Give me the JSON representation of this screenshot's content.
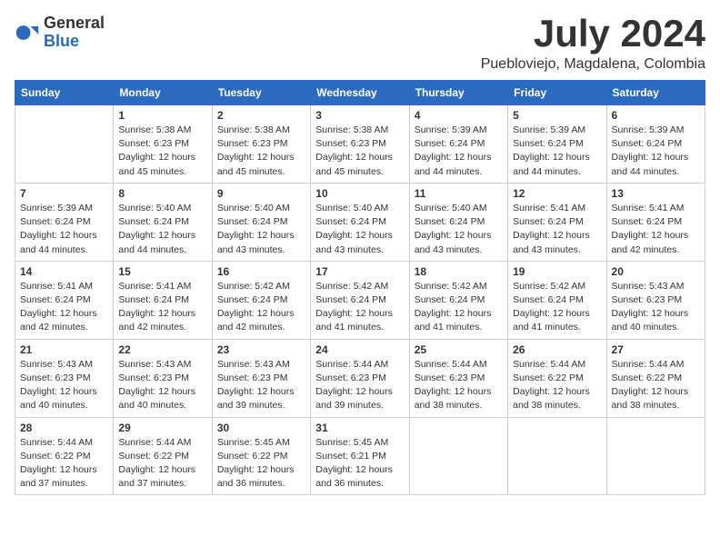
{
  "logo": {
    "general": "General",
    "blue": "Blue"
  },
  "title": "July 2024",
  "location": "Puebloviejo, Magdalena, Colombia",
  "days_of_week": [
    "Sunday",
    "Monday",
    "Tuesday",
    "Wednesday",
    "Thursday",
    "Friday",
    "Saturday"
  ],
  "weeks": [
    [
      {
        "day": "",
        "info": ""
      },
      {
        "day": "1",
        "info": "Sunrise: 5:38 AM\nSunset: 6:23 PM\nDaylight: 12 hours\nand 45 minutes."
      },
      {
        "day": "2",
        "info": "Sunrise: 5:38 AM\nSunset: 6:23 PM\nDaylight: 12 hours\nand 45 minutes."
      },
      {
        "day": "3",
        "info": "Sunrise: 5:38 AM\nSunset: 6:23 PM\nDaylight: 12 hours\nand 45 minutes."
      },
      {
        "day": "4",
        "info": "Sunrise: 5:39 AM\nSunset: 6:24 PM\nDaylight: 12 hours\nand 44 minutes."
      },
      {
        "day": "5",
        "info": "Sunrise: 5:39 AM\nSunset: 6:24 PM\nDaylight: 12 hours\nand 44 minutes."
      },
      {
        "day": "6",
        "info": "Sunrise: 5:39 AM\nSunset: 6:24 PM\nDaylight: 12 hours\nand 44 minutes."
      }
    ],
    [
      {
        "day": "7",
        "info": "Sunrise: 5:39 AM\nSunset: 6:24 PM\nDaylight: 12 hours\nand 44 minutes."
      },
      {
        "day": "8",
        "info": "Sunrise: 5:40 AM\nSunset: 6:24 PM\nDaylight: 12 hours\nand 44 minutes."
      },
      {
        "day": "9",
        "info": "Sunrise: 5:40 AM\nSunset: 6:24 PM\nDaylight: 12 hours\nand 43 minutes."
      },
      {
        "day": "10",
        "info": "Sunrise: 5:40 AM\nSunset: 6:24 PM\nDaylight: 12 hours\nand 43 minutes."
      },
      {
        "day": "11",
        "info": "Sunrise: 5:40 AM\nSunset: 6:24 PM\nDaylight: 12 hours\nand 43 minutes."
      },
      {
        "day": "12",
        "info": "Sunrise: 5:41 AM\nSunset: 6:24 PM\nDaylight: 12 hours\nand 43 minutes."
      },
      {
        "day": "13",
        "info": "Sunrise: 5:41 AM\nSunset: 6:24 PM\nDaylight: 12 hours\nand 42 minutes."
      }
    ],
    [
      {
        "day": "14",
        "info": "Sunrise: 5:41 AM\nSunset: 6:24 PM\nDaylight: 12 hours\nand 42 minutes."
      },
      {
        "day": "15",
        "info": "Sunrise: 5:41 AM\nSunset: 6:24 PM\nDaylight: 12 hours\nand 42 minutes."
      },
      {
        "day": "16",
        "info": "Sunrise: 5:42 AM\nSunset: 6:24 PM\nDaylight: 12 hours\nand 42 minutes."
      },
      {
        "day": "17",
        "info": "Sunrise: 5:42 AM\nSunset: 6:24 PM\nDaylight: 12 hours\nand 41 minutes."
      },
      {
        "day": "18",
        "info": "Sunrise: 5:42 AM\nSunset: 6:24 PM\nDaylight: 12 hours\nand 41 minutes."
      },
      {
        "day": "19",
        "info": "Sunrise: 5:42 AM\nSunset: 6:24 PM\nDaylight: 12 hours\nand 41 minutes."
      },
      {
        "day": "20",
        "info": "Sunrise: 5:43 AM\nSunset: 6:23 PM\nDaylight: 12 hours\nand 40 minutes."
      }
    ],
    [
      {
        "day": "21",
        "info": "Sunrise: 5:43 AM\nSunset: 6:23 PM\nDaylight: 12 hours\nand 40 minutes."
      },
      {
        "day": "22",
        "info": "Sunrise: 5:43 AM\nSunset: 6:23 PM\nDaylight: 12 hours\nand 40 minutes."
      },
      {
        "day": "23",
        "info": "Sunrise: 5:43 AM\nSunset: 6:23 PM\nDaylight: 12 hours\nand 39 minutes."
      },
      {
        "day": "24",
        "info": "Sunrise: 5:44 AM\nSunset: 6:23 PM\nDaylight: 12 hours\nand 39 minutes."
      },
      {
        "day": "25",
        "info": "Sunrise: 5:44 AM\nSunset: 6:23 PM\nDaylight: 12 hours\nand 38 minutes."
      },
      {
        "day": "26",
        "info": "Sunrise: 5:44 AM\nSunset: 6:22 PM\nDaylight: 12 hours\nand 38 minutes."
      },
      {
        "day": "27",
        "info": "Sunrise: 5:44 AM\nSunset: 6:22 PM\nDaylight: 12 hours\nand 38 minutes."
      }
    ],
    [
      {
        "day": "28",
        "info": "Sunrise: 5:44 AM\nSunset: 6:22 PM\nDaylight: 12 hours\nand 37 minutes."
      },
      {
        "day": "29",
        "info": "Sunrise: 5:44 AM\nSunset: 6:22 PM\nDaylight: 12 hours\nand 37 minutes."
      },
      {
        "day": "30",
        "info": "Sunrise: 5:45 AM\nSunset: 6:22 PM\nDaylight: 12 hours\nand 36 minutes."
      },
      {
        "day": "31",
        "info": "Sunrise: 5:45 AM\nSunset: 6:21 PM\nDaylight: 12 hours\nand 36 minutes."
      },
      {
        "day": "",
        "info": ""
      },
      {
        "day": "",
        "info": ""
      },
      {
        "day": "",
        "info": ""
      }
    ]
  ]
}
